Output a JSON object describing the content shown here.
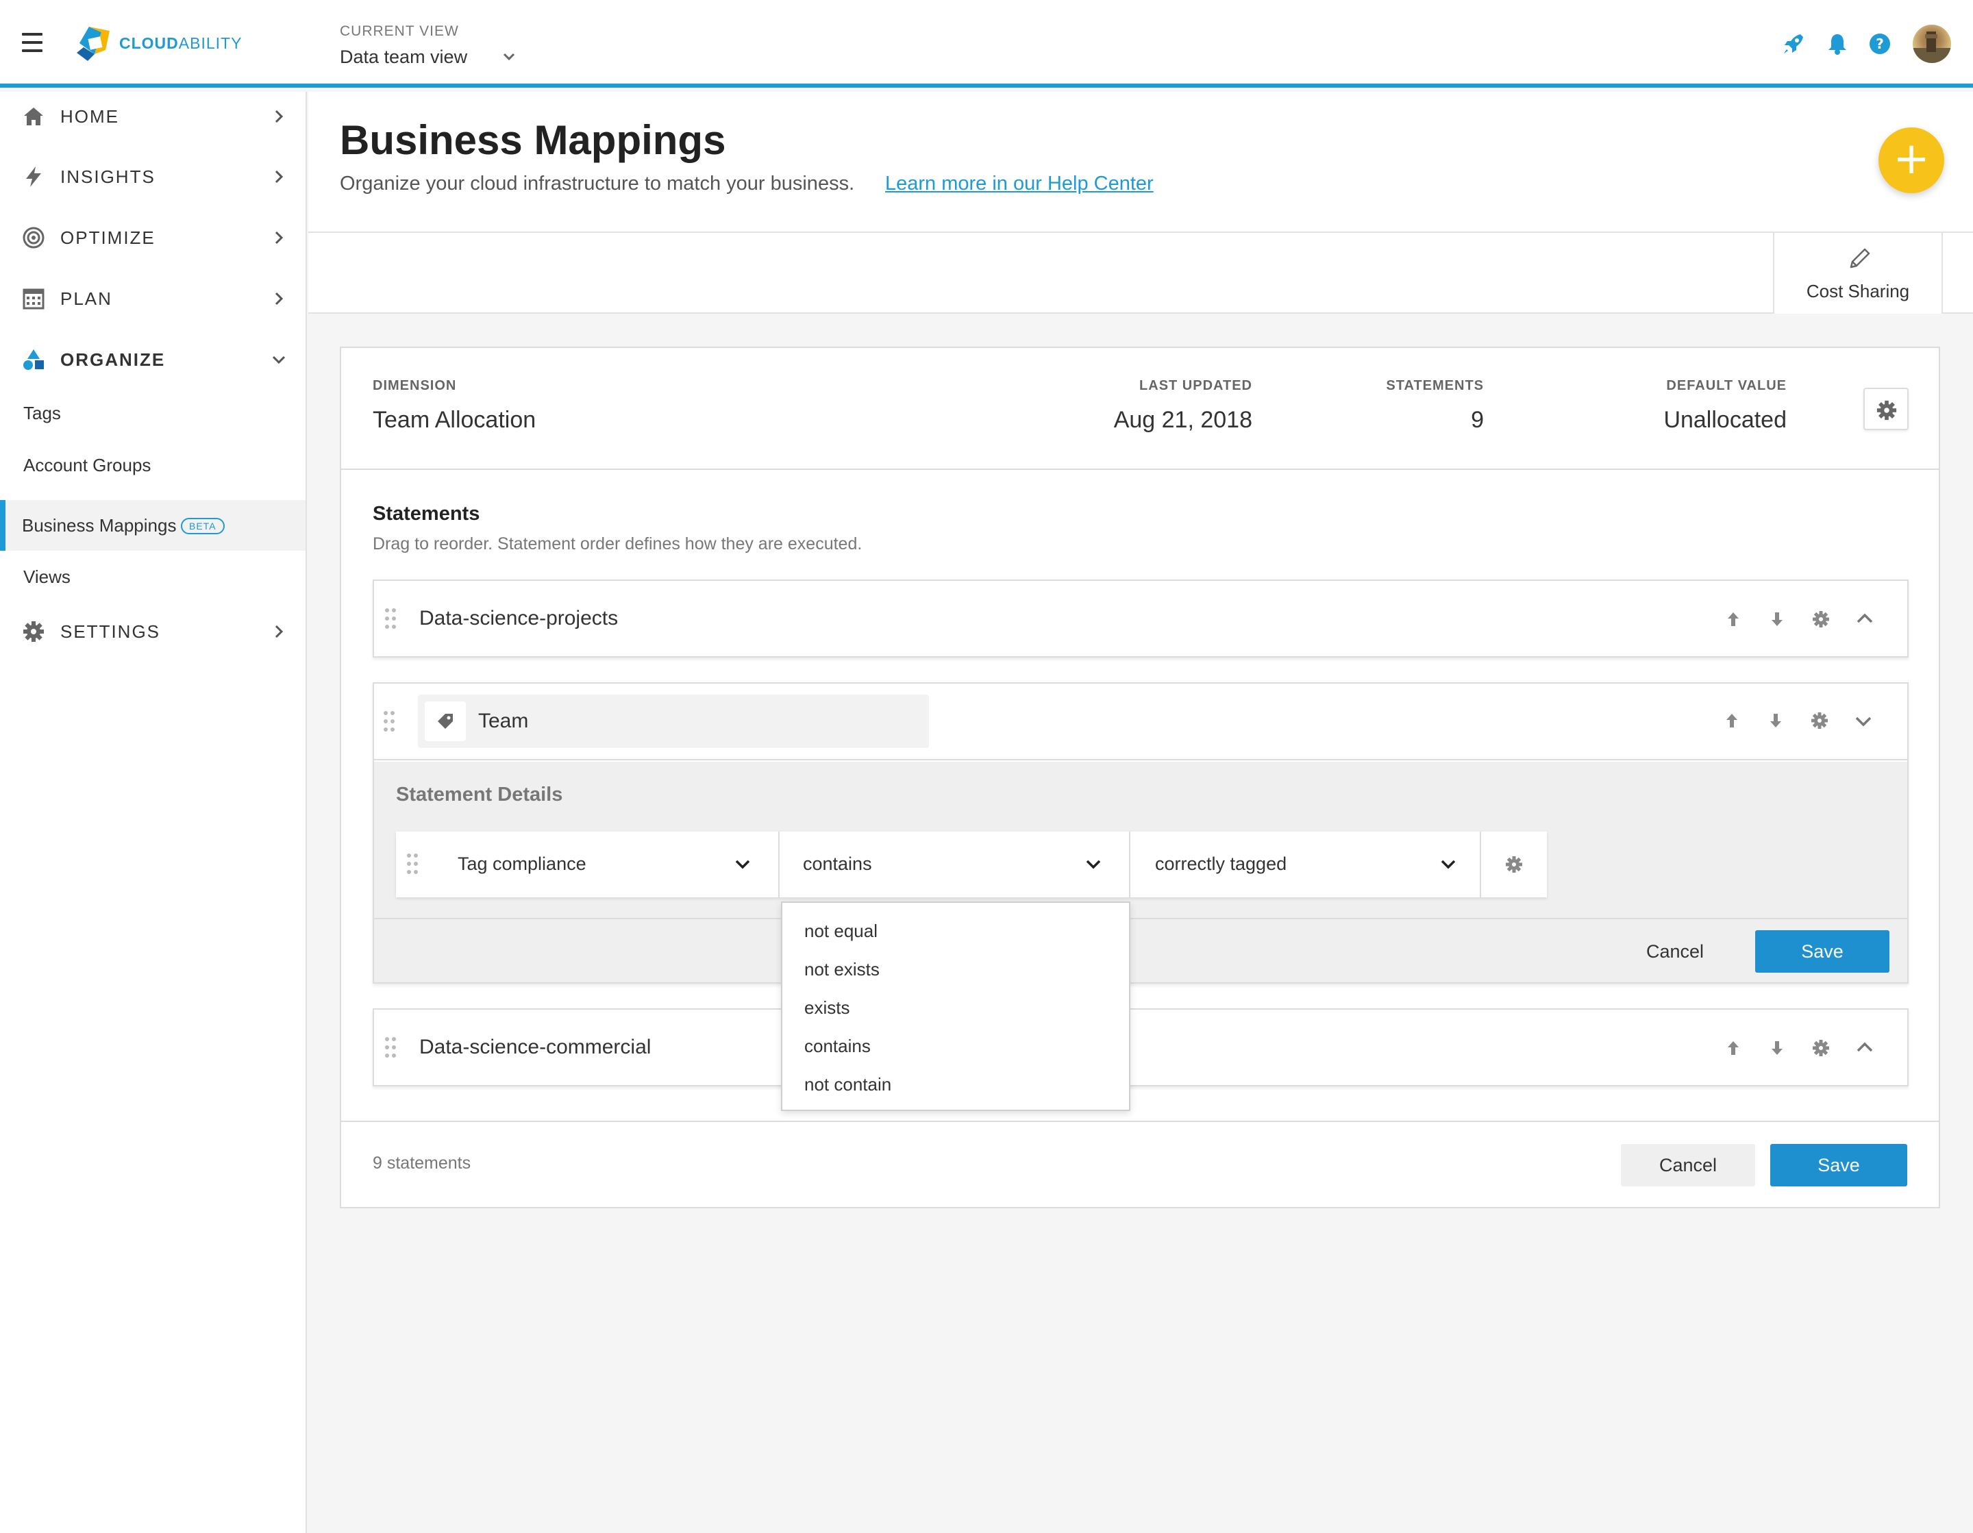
{
  "app": {
    "brand": "CLOUDABILITY",
    "brand_bold": "CLOUD",
    "brand_rest": "ABILITY"
  },
  "topbar": {
    "current_view_label": "CURRENT VIEW",
    "current_view_value": "Data team view"
  },
  "sidebar": {
    "nav": [
      {
        "label": "HOME",
        "icon": "home-icon"
      },
      {
        "label": "INSIGHTS",
        "icon": "bolt-icon"
      },
      {
        "label": "OPTIMIZE",
        "icon": "target-icon"
      },
      {
        "label": "PLAN",
        "icon": "calendar-icon"
      },
      {
        "label": "ORGANIZE",
        "icon": "shapes-icon"
      },
      {
        "label": "SETTINGS",
        "icon": "gear-icon"
      }
    ],
    "organize_items": [
      {
        "label": "Tags"
      },
      {
        "label": "Account Groups"
      },
      {
        "label": "Business Mappings",
        "badge": "BETA"
      },
      {
        "label": "Views"
      }
    ]
  },
  "page": {
    "title": "Business Mappings",
    "subtitle": "Organize your cloud infrastructure to match your business.",
    "help_link": "Learn more in our Help Center"
  },
  "tabs": {
    "cost_sharing": "Cost Sharing"
  },
  "mapping": {
    "dimension_label": "DIMENSION",
    "dimension_value": "Team Allocation",
    "last_updated_label": "LAST UPDATED",
    "last_updated_value": "Aug 21, 2018",
    "statements_label": "STATEMENTS",
    "statements_value": "9",
    "default_label": "DEFAULT VALUE",
    "default_value": "Unallocated"
  },
  "statements": {
    "title": "Statements",
    "subtitle": "Drag to reorder. Statement order defines how they are executed.",
    "rows": [
      {
        "label": "Data-science-projects"
      },
      {
        "label": "Team"
      },
      {
        "label": "Data-science-commercial"
      }
    ],
    "details": {
      "title": "Statement Details",
      "field": "Tag compliance",
      "operator": "contains",
      "value": "correctly tagged",
      "cancel": "Cancel",
      "save": "Save"
    },
    "operator_options": [
      "not equal",
      "not exists",
      "exists",
      "contains",
      "not contain"
    ]
  },
  "footer": {
    "count": "9 statements",
    "cancel": "Cancel",
    "save": "Save"
  },
  "colors": {
    "accent": "#1e9ad6",
    "fab": "#f7c21a",
    "save": "#1e8fcf"
  }
}
